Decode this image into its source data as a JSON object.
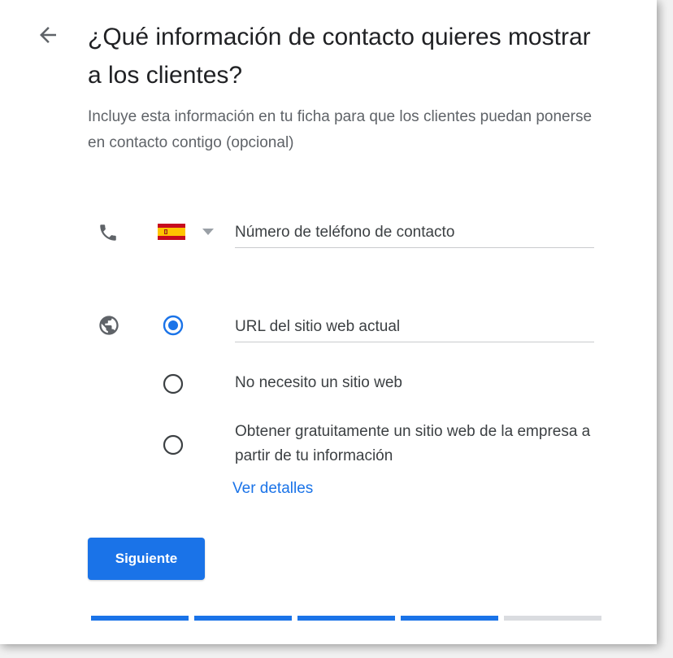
{
  "header": {
    "title": "¿Qué información de contacto quieres mostrar a los clientes?",
    "subtitle": "Incluye esta información en tu ficha para que los clientes puedan ponerse en contacto contigo (opcional)"
  },
  "phone": {
    "icon": "phone-icon",
    "country_flag": "spain-flag",
    "placeholder": "Número de teléfono de contacto",
    "value": ""
  },
  "website": {
    "icon": "globe-icon",
    "url_placeholder": "URL del sitio web actual",
    "url_value": "",
    "options": [
      {
        "label": "URL del sitio web actual",
        "selected": true
      },
      {
        "label": "No necesito un sitio web",
        "selected": false
      },
      {
        "label": "Obtener gratuitamente un sitio web de la empresa a partir de tu información",
        "selected": false
      }
    ],
    "details_link": "Ver detalles"
  },
  "actions": {
    "next_label": "Siguiente"
  },
  "progress": {
    "total_steps": 5,
    "completed_steps": 4
  },
  "colors": {
    "accent": "#1a73e8",
    "progress_inactive": "#dadce0",
    "icon_gray": "#5f6368"
  }
}
